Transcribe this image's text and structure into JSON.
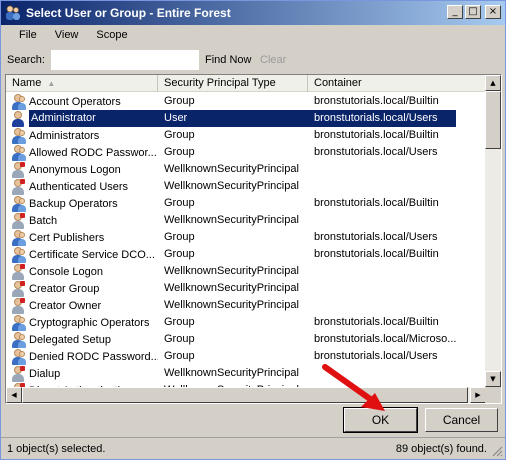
{
  "window": {
    "title": "Select User or Group - Entire Forest",
    "minimize": "_",
    "maximize": "□",
    "close": "×"
  },
  "menu": [
    "File",
    "View",
    "Scope"
  ],
  "search": {
    "label": "Search:",
    "value": "",
    "find_now": "Find Now",
    "clear": "Clear"
  },
  "columns": [
    "Name",
    "Security Principal Type",
    "Container"
  ],
  "rows": [
    {
      "name": "Account Operators",
      "type": "Group",
      "container": "bronstutorials.local/Builtin",
      "icon": "group-icon"
    },
    {
      "name": "Administrator",
      "type": "User",
      "container": "bronstutorials.local/Users",
      "icon": "user-icon",
      "selected": true
    },
    {
      "name": "Administrators",
      "type": "Group",
      "container": "bronstutorials.local/Builtin",
      "icon": "group-icon"
    },
    {
      "name": "Allowed RODC Passwor...",
      "type": "Group",
      "container": "bronstutorials.local/Users",
      "icon": "group-icon"
    },
    {
      "name": "Anonymous Logon",
      "type": "WellknownSecurityPrincipal",
      "container": "",
      "icon": "wellknown-icon"
    },
    {
      "name": "Authenticated Users",
      "type": "WellknownSecurityPrincipal",
      "container": "",
      "icon": "wellknown-icon"
    },
    {
      "name": "Backup Operators",
      "type": "Group",
      "container": "bronstutorials.local/Builtin",
      "icon": "group-icon"
    },
    {
      "name": "Batch",
      "type": "WellknownSecurityPrincipal",
      "container": "",
      "icon": "wellknown-icon"
    },
    {
      "name": "Cert Publishers",
      "type": "Group",
      "container": "bronstutorials.local/Users",
      "icon": "group-icon"
    },
    {
      "name": "Certificate Service DCO...",
      "type": "Group",
      "container": "bronstutorials.local/Builtin",
      "icon": "group-icon"
    },
    {
      "name": "Console Logon",
      "type": "WellknownSecurityPrincipal",
      "container": "",
      "icon": "wellknown-icon"
    },
    {
      "name": "Creator Group",
      "type": "WellknownSecurityPrincipal",
      "container": "",
      "icon": "wellknown-icon"
    },
    {
      "name": "Creator Owner",
      "type": "WellknownSecurityPrincipal",
      "container": "",
      "icon": "wellknown-icon"
    },
    {
      "name": "Cryptographic Operators",
      "type": "Group",
      "container": "bronstutorials.local/Builtin",
      "icon": "group-icon"
    },
    {
      "name": "Delegated Setup",
      "type": "Group",
      "container": "bronstutorials.local/Microso...",
      "icon": "group-icon"
    },
    {
      "name": "Denied RODC Password...",
      "type": "Group",
      "container": "bronstutorials.local/Users",
      "icon": "group-icon"
    },
    {
      "name": "Dialup",
      "type": "WellknownSecurityPrincipal",
      "container": "",
      "icon": "wellknown-icon"
    },
    {
      "name": "Digest Authentication",
      "type": "WellknownSecurityPrincipal",
      "container": "",
      "icon": "wellknown-icon"
    }
  ],
  "buttons": {
    "ok": "OK",
    "cancel": "Cancel"
  },
  "status": {
    "left": "1 object(s) selected.",
    "right": "89 object(s) found."
  },
  "colors": {
    "title_start": "#0a246a",
    "title_end": "#a6caf0",
    "selection": "#0a246a",
    "arrow": "#e01010"
  }
}
